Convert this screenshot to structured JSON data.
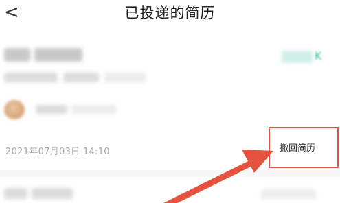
{
  "header": {
    "back_icon": "chevron-left-icon",
    "back_glyph": "<",
    "title": "已投递的简历"
  },
  "application": {
    "salary_unit": "K",
    "submitted_at": "2021年07月03日 14:10",
    "withdraw_label": "撤回简历"
  },
  "annotation": {
    "color": "#e5533e"
  }
}
